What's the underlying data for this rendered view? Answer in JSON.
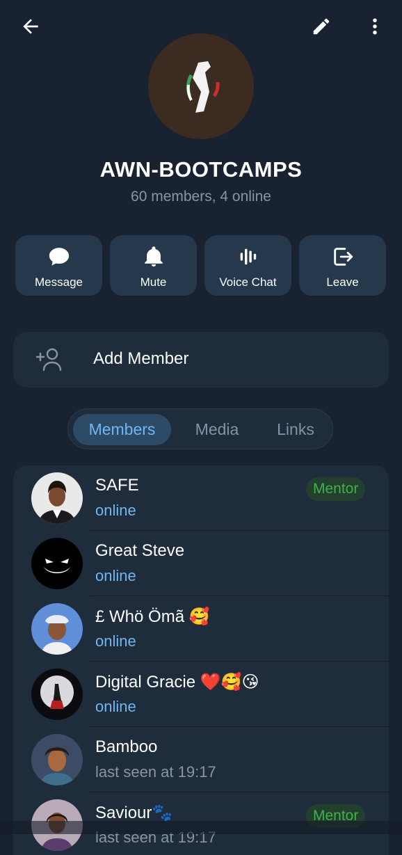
{
  "header": {
    "back_icon": "arrow-left-icon",
    "edit_icon": "pencil-icon",
    "more_icon": "more-vertical-icon"
  },
  "group": {
    "title": "AWN-BOOTCAMPS",
    "subtitle": "60 members, 4 online"
  },
  "actions": [
    {
      "label": "Message",
      "icon": "chat-bubble-icon"
    },
    {
      "label": "Mute",
      "icon": "bell-icon"
    },
    {
      "label": "Voice Chat",
      "icon": "voice-bars-icon"
    },
    {
      "label": "Leave",
      "icon": "logout-icon"
    }
  ],
  "add_member": {
    "label": "Add Member",
    "icon": "add-person-icon"
  },
  "tabs": [
    {
      "label": "Members",
      "active": true
    },
    {
      "label": "Media",
      "active": false
    },
    {
      "label": "Links",
      "active": false
    }
  ],
  "members": [
    {
      "name": "SAFE",
      "status": "online",
      "badge": "Mentor"
    },
    {
      "name": "Great Steve",
      "status": "online",
      "badge": ""
    },
    {
      "name": "£ Whö Ömã 🥰",
      "status": "online",
      "badge": ""
    },
    {
      "name": "Digital Gracie ❤️🥰😘",
      "status": "online",
      "badge": ""
    },
    {
      "name": "Bamboo",
      "status": "last seen at 19:17",
      "badge": ""
    },
    {
      "name": "Saviour🐾",
      "status": "last seen at 19:17",
      "badge": "Mentor"
    }
  ],
  "colors": {
    "background": "#182230",
    "card": "#1f2c3b",
    "action_button": "#26384c",
    "accent_blue": "#6fb7f2",
    "mentor_green": "#3fb04a"
  }
}
